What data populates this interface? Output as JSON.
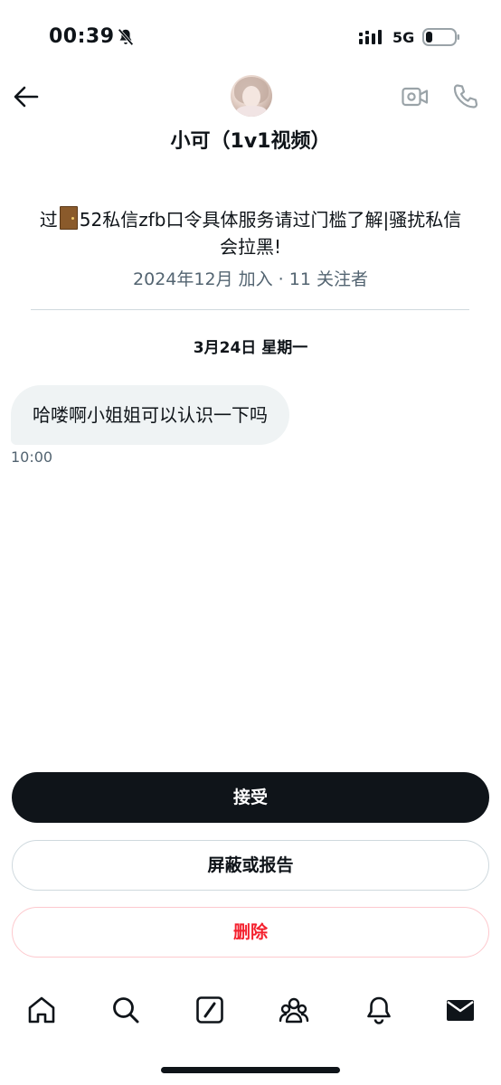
{
  "status_bar": {
    "time": "00:39",
    "network": "5G"
  },
  "header": {
    "name": "小可（1v1视频）",
    "icons": [
      "back-arrow-icon",
      "video-camera-icon",
      "phone-icon"
    ]
  },
  "profile": {
    "bio_before_emoji": "过",
    "bio_emoji": "door",
    "bio_after_emoji": "52私信zfb口令具体服务请过门槛了解|骚扰私信会拉黑!",
    "meta": "2024年12月 加入 · 11 关注者"
  },
  "conversation": {
    "date": "3月24日 星期一",
    "messages": [
      {
        "text": "哈喽啊小姐姐可以认识一下吗",
        "time": "10:00"
      }
    ]
  },
  "actions": {
    "accept": "接受",
    "block_report": "屏蔽或报告",
    "delete": "删除"
  },
  "bottom_nav": [
    "home-icon",
    "search-icon",
    "compose-icon",
    "communities-icon",
    "notifications-icon",
    "messages-icon"
  ],
  "colors": {
    "text": "#0f1419",
    "secondary_text": "#536471",
    "bubble_bg": "#eff3f4",
    "danger": "#f4212e",
    "divider": "#cfd9de"
  }
}
